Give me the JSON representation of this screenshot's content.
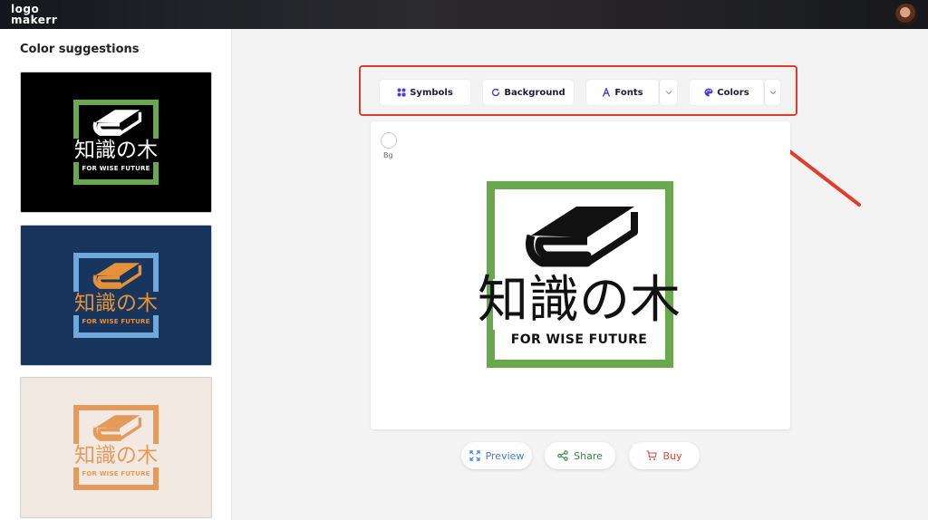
{
  "app": {
    "logo_line1": "logo",
    "logo_line2": "makerr"
  },
  "sidebar": {
    "title": "Color suggestions",
    "cards": [
      {
        "kanji": "知識の木",
        "tagline": "FOR WISE FUTURE",
        "bg": "#000000",
        "frame": "#6aa84f",
        "ink": "#ffffff"
      },
      {
        "kanji": "知識の木",
        "tagline": "FOR WISE FUTURE",
        "bg": "#17355d",
        "frame": "#6fa8dc",
        "ink": "#e69138"
      },
      {
        "kanji": "知識の木",
        "tagline": "FOR WISE FUTURE",
        "bg": "#f3e9e3",
        "frame": "#e69a5a",
        "ink": "#e69a5a"
      }
    ]
  },
  "toolbar": {
    "symbols": "Symbols",
    "background": "Background",
    "fonts": "Fonts",
    "colors": "Colors"
  },
  "canvas": {
    "bg_label": "Bg",
    "kanji": "知識の木",
    "tagline": "FOR WISE FUTURE",
    "frame_color": "#6aa84f"
  },
  "actions": {
    "preview": "Preview",
    "share": "Share",
    "buy": "Buy"
  },
  "colors": {
    "highlight": "#e53b2c",
    "accent_blue": "#3c7be8",
    "accent_green": "#2e8a3b",
    "accent_red": "#e0483a"
  }
}
